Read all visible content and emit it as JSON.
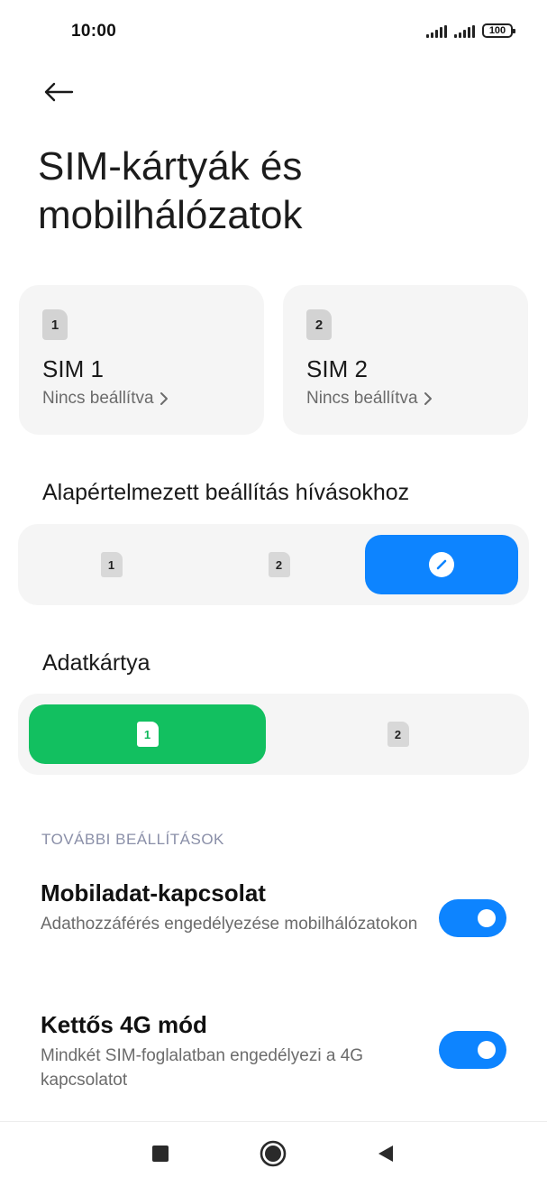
{
  "status_bar": {
    "time": "10:00",
    "battery": "100",
    "icons": [
      "signal-icon",
      "signal-icon",
      "battery-icon"
    ]
  },
  "header": {
    "back_icon": "arrow-left-icon",
    "title": "SIM-kártyák és mobilhálózatok"
  },
  "sim_cards": [
    {
      "slot": "1",
      "name": "SIM 1",
      "status": "Nincs beállítva"
    },
    {
      "slot": "2",
      "name": "SIM 2",
      "status": "Nincs beállítva"
    }
  ],
  "calls_default": {
    "label": "Alapértelmezett beállítás hívásokhoz",
    "options": [
      {
        "chip": "1",
        "selected": false
      },
      {
        "chip": "2",
        "selected": false
      },
      {
        "icon": "edit-icon",
        "selected": true
      }
    ],
    "accent_color": "#0D84FF"
  },
  "data_card": {
    "label": "Adatkártya",
    "options": [
      {
        "chip": "1",
        "selected": true
      },
      {
        "chip": "2",
        "selected": false
      }
    ],
    "accent_color": "#12C060"
  },
  "more_settings": {
    "section_label": "TOVÁBBI BEÁLLÍTÁSOK",
    "items": [
      {
        "title": "Mobiladat-kapcsolat",
        "subtitle": "Adathozzáférés engedélyezése mobilhálózatokon",
        "enabled": true
      },
      {
        "title": "Kettős 4G mód",
        "subtitle": "Mindkét SIM-foglalatban engedélyezi a 4G kapcsolatot",
        "enabled": true
      }
    ],
    "toggle_color": "#0D84FF"
  },
  "nav_bar": {
    "buttons": [
      "recents-square-icon",
      "home-circle-icon",
      "back-triangle-icon"
    ]
  }
}
